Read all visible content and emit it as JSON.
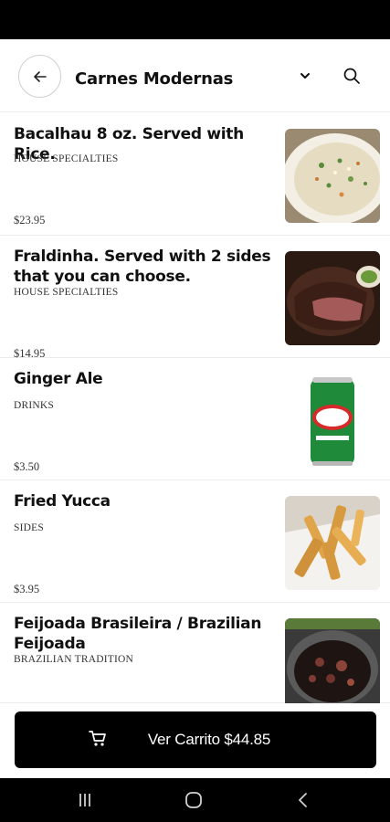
{
  "header": {
    "title": "Carnes Modernas"
  },
  "menu": {
    "items": [
      {
        "name": "Bacalhau 8 oz. Served with Rice.",
        "category": "HOUSE SPECIALTIES",
        "price": "$23.95"
      },
      {
        "name": "Fraldinha. Served with 2 sides that you can choose.",
        "category": "HOUSE SPECIALTIES",
        "price": "$14.95"
      },
      {
        "name": "Ginger Ale",
        "category": "DRINKS",
        "price": "$3.50"
      },
      {
        "name": "Fried Yucca",
        "category": "SIDES",
        "price": "$3.95"
      },
      {
        "name": "Feijoada Brasileira / Brazilian Feijoada",
        "category": "BRAZILIAN TRADITION",
        "price": ""
      }
    ]
  },
  "cart": {
    "label": "Ver Carrito $44.85"
  },
  "colors": {
    "primary": "#000000",
    "background": "#ffffff",
    "divider": "#ececec"
  },
  "icons": {
    "back": "arrow-left-icon",
    "dropdown": "chevron-down-icon",
    "search": "search-icon",
    "cart": "cart-icon",
    "nav_recents": "recents-icon",
    "nav_home": "home-icon",
    "nav_back": "back-icon"
  }
}
